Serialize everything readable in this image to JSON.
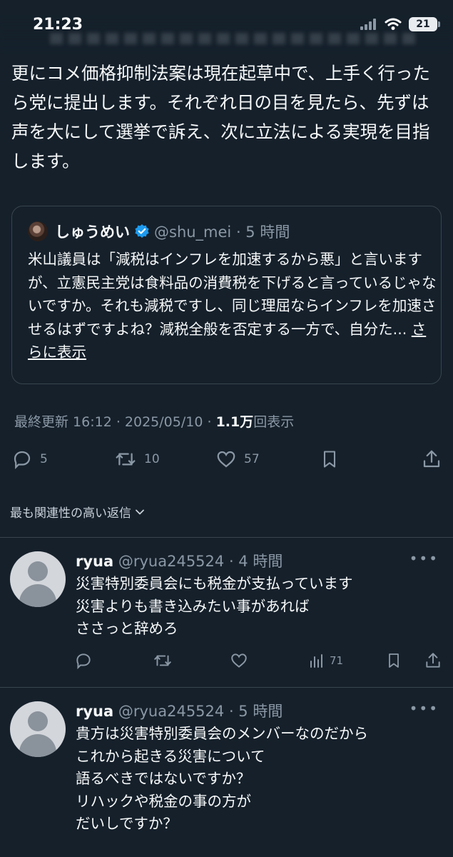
{
  "status_bar": {
    "time": "21:23",
    "battery": "21"
  },
  "tweet": {
    "body": "更にコメ価格抑制法案は現在起草中で、上手く行ったら党に提出します。それぞれ日の目を見たら、先ずは声を大にして選挙で訴え、次に立法による実現を目指します。",
    "quote": {
      "name": "しゅうめい",
      "handle_time": "@shu_mei · 5 時間",
      "text": "米山議員は「減税はインフレを加速するから悪」と言いますが、立憲民主党は食料品の消費税を下げると言っているじゃないですか。それも減税ですし、同じ理屈ならインフレを加速させるはずですよね？減税全般を否定する一方で、自分た... ",
      "show_more": "さらに表示"
    },
    "meta": {
      "updated": "最終更新 16:12 · 2025/05/10",
      "views_count": "1.1万",
      "views_label": "回表示"
    },
    "actions": {
      "replies": "5",
      "retweets": "10",
      "likes": "57"
    }
  },
  "sort_label": "最も関連性の高い返信",
  "replies": [
    {
      "name": "ryua",
      "handle_time": "@ryua245524 · 4 時間",
      "text": "災害特別委員会にも税金が支払っています\n災害よりも書き込みたい事があれば\nささっと辞めろ",
      "views": "71"
    },
    {
      "name": "ryua",
      "handle_time": "@ryua245524 · 5 時間",
      "text": "貴方は災害特別委員会のメンバーなのだから\nこれから起きる災害について\n語るべきではないですか？\nリハックや税金の事の方が\nだいしですか？"
    }
  ],
  "colors": {
    "background": "#15202b",
    "text": "#f7f9f9",
    "muted": "#8b98a5",
    "verified": "#1d9bf0",
    "border": "#38444d"
  }
}
